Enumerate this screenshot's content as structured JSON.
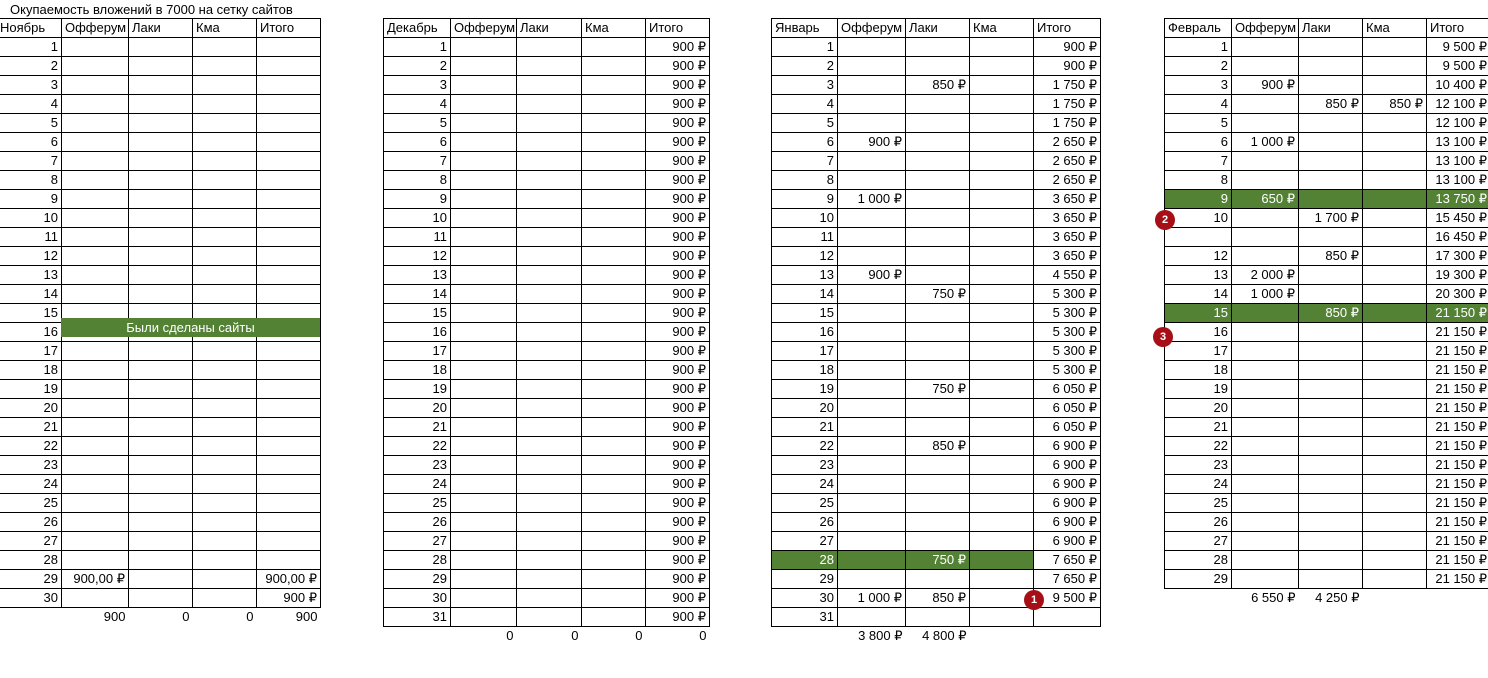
{
  "title": "Окупаемость вложений в 7000 на сетку сайтов",
  "banner": "Были сделаны сайты",
  "colors": {
    "green": "#548235",
    "badge": "#a50f15"
  },
  "badges": [
    "1",
    "2",
    "3"
  ],
  "november": {
    "headers": [
      "Ноябрь",
      "Офферум",
      "Лаки",
      "Кма",
      "Итого"
    ],
    "rows": [
      [
        "1",
        "",
        "",
        "",
        ""
      ],
      [
        "2",
        "",
        "",
        "",
        ""
      ],
      [
        "3",
        "",
        "",
        "",
        ""
      ],
      [
        "4",
        "",
        "",
        "",
        ""
      ],
      [
        "5",
        "",
        "",
        "",
        ""
      ],
      [
        "6",
        "",
        "",
        "",
        ""
      ],
      [
        "7",
        "",
        "",
        "",
        ""
      ],
      [
        "8",
        "",
        "",
        "",
        ""
      ],
      [
        "9",
        "",
        "",
        "",
        ""
      ],
      [
        "10",
        "",
        "",
        "",
        ""
      ],
      [
        "11",
        "",
        "",
        "",
        ""
      ],
      [
        "12",
        "",
        "",
        "",
        ""
      ],
      [
        "13",
        "",
        "",
        "",
        ""
      ],
      [
        "14",
        "",
        "",
        "",
        ""
      ],
      [
        "15",
        "",
        "",
        "",
        ""
      ],
      [
        "16",
        "",
        "",
        "",
        ""
      ],
      [
        "17",
        "",
        "",
        "",
        ""
      ],
      [
        "18",
        "",
        "",
        "",
        ""
      ],
      [
        "19",
        "",
        "",
        "",
        ""
      ],
      [
        "20",
        "",
        "",
        "",
        ""
      ],
      [
        "21",
        "",
        "",
        "",
        ""
      ],
      [
        "22",
        "",
        "",
        "",
        ""
      ],
      [
        "23",
        "",
        "",
        "",
        ""
      ],
      [
        "24",
        "",
        "",
        "",
        ""
      ],
      [
        "25",
        "",
        "",
        "",
        ""
      ],
      [
        "26",
        "",
        "",
        "",
        ""
      ],
      [
        "27",
        "",
        "",
        "",
        ""
      ],
      [
        "28",
        "",
        "",
        "",
        ""
      ],
      [
        "29",
        "900,00 ₽",
        "",
        "",
        "900,00 ₽"
      ],
      [
        "30",
        "",
        "",
        "",
        "900 ₽"
      ]
    ],
    "totals": [
      "",
      "900",
      "0",
      "0",
      "900"
    ]
  },
  "december": {
    "headers": [
      "Декабрь",
      "Офферум",
      "Лаки",
      "Кма",
      "Итого"
    ],
    "rows": [
      [
        "1",
        "",
        "",
        "",
        "900 ₽"
      ],
      [
        "2",
        "",
        "",
        "",
        "900 ₽"
      ],
      [
        "3",
        "",
        "",
        "",
        "900 ₽"
      ],
      [
        "4",
        "",
        "",
        "",
        "900 ₽"
      ],
      [
        "5",
        "",
        "",
        "",
        "900 ₽"
      ],
      [
        "6",
        "",
        "",
        "",
        "900 ₽"
      ],
      [
        "7",
        "",
        "",
        "",
        "900 ₽"
      ],
      [
        "8",
        "",
        "",
        "",
        "900 ₽"
      ],
      [
        "9",
        "",
        "",
        "",
        "900 ₽"
      ],
      [
        "10",
        "",
        "",
        "",
        "900 ₽"
      ],
      [
        "11",
        "",
        "",
        "",
        "900 ₽"
      ],
      [
        "12",
        "",
        "",
        "",
        "900 ₽"
      ],
      [
        "13",
        "",
        "",
        "",
        "900 ₽"
      ],
      [
        "14",
        "",
        "",
        "",
        "900 ₽"
      ],
      [
        "15",
        "",
        "",
        "",
        "900 ₽"
      ],
      [
        "16",
        "",
        "",
        "",
        "900 ₽"
      ],
      [
        "17",
        "",
        "",
        "",
        "900 ₽"
      ],
      [
        "18",
        "",
        "",
        "",
        "900 ₽"
      ],
      [
        "19",
        "",
        "",
        "",
        "900 ₽"
      ],
      [
        "20",
        "",
        "",
        "",
        "900 ₽"
      ],
      [
        "21",
        "",
        "",
        "",
        "900 ₽"
      ],
      [
        "22",
        "",
        "",
        "",
        "900 ₽"
      ],
      [
        "23",
        "",
        "",
        "",
        "900 ₽"
      ],
      [
        "24",
        "",
        "",
        "",
        "900 ₽"
      ],
      [
        "25",
        "",
        "",
        "",
        "900 ₽"
      ],
      [
        "26",
        "",
        "",
        "",
        "900 ₽"
      ],
      [
        "27",
        "",
        "",
        "",
        "900 ₽"
      ],
      [
        "28",
        "",
        "",
        "",
        "900 ₽"
      ],
      [
        "29",
        "",
        "",
        "",
        "900 ₽"
      ],
      [
        "30",
        "",
        "",
        "",
        "900 ₽"
      ],
      [
        "31",
        "",
        "",
        "",
        "900 ₽"
      ]
    ],
    "totals": [
      "",
      "0",
      "0",
      "0",
      "0"
    ]
  },
  "january": {
    "headers": [
      "Январь",
      "Офферум",
      "Лаки",
      "Кма",
      "Итого"
    ],
    "rows": [
      [
        "1",
        "",
        "",
        "",
        "900 ₽"
      ],
      [
        "2",
        "",
        "",
        "",
        "900 ₽"
      ],
      [
        "3",
        "",
        "850 ₽",
        "",
        "1 750 ₽"
      ],
      [
        "4",
        "",
        "",
        "",
        "1 750 ₽"
      ],
      [
        "5",
        "",
        "",
        "",
        "1 750 ₽"
      ],
      [
        "6",
        "900 ₽",
        "",
        "",
        "2 650 ₽"
      ],
      [
        "7",
        "",
        "",
        "",
        "2 650 ₽"
      ],
      [
        "8",
        "",
        "",
        "",
        "2 650 ₽"
      ],
      [
        "9",
        "1 000 ₽",
        "",
        "",
        "3 650 ₽"
      ],
      [
        "10",
        "",
        "",
        "",
        "3 650 ₽"
      ],
      [
        "11",
        "",
        "",
        "",
        "3 650 ₽"
      ],
      [
        "12",
        "",
        "",
        "",
        "3 650 ₽"
      ],
      [
        "13",
        "900 ₽",
        "",
        "",
        "4 550 ₽"
      ],
      [
        "14",
        "",
        "750 ₽",
        "",
        "5 300 ₽"
      ],
      [
        "15",
        "",
        "",
        "",
        "5 300 ₽"
      ],
      [
        "16",
        "",
        "",
        "",
        "5 300 ₽"
      ],
      [
        "17",
        "",
        "",
        "",
        "5 300 ₽"
      ],
      [
        "18",
        "",
        "",
        "",
        "5 300 ₽"
      ],
      [
        "19",
        "",
        "750 ₽",
        "",
        "6 050 ₽"
      ],
      [
        "20",
        "",
        "",
        "",
        "6 050 ₽"
      ],
      [
        "21",
        "",
        "",
        "",
        "6 050 ₽"
      ],
      [
        "22",
        "",
        "850 ₽",
        "",
        "6 900 ₽"
      ],
      [
        "23",
        "",
        "",
        "",
        "6 900 ₽"
      ],
      [
        "24",
        "",
        "",
        "",
        "6 900 ₽"
      ],
      [
        "25",
        "",
        "",
        "",
        "6 900 ₽"
      ],
      [
        "26",
        "",
        "",
        "",
        "6 900 ₽"
      ],
      [
        "27",
        "",
        "",
        "",
        "6 900 ₽"
      ],
      [
        "28",
        "",
        "750 ₽",
        "",
        "7 650 ₽"
      ],
      [
        "29",
        "",
        "",
        "",
        "7 650 ₽"
      ],
      [
        "30",
        "1 000 ₽",
        "850 ₽",
        "",
        "9 500 ₽"
      ],
      [
        "31",
        "",
        "",
        "",
        ""
      ]
    ],
    "totals": [
      "",
      "3 800 ₽",
      "4 800 ₽",
      "",
      ""
    ]
  },
  "february": {
    "headers": [
      "Февраль",
      "Офферум",
      "Лаки",
      "Кма",
      "Итого"
    ],
    "rows": [
      [
        "1",
        "",
        "",
        "",
        "9 500 ₽"
      ],
      [
        "2",
        "",
        "",
        "",
        "9 500 ₽"
      ],
      [
        "3",
        "900 ₽",
        "",
        "",
        "10 400 ₽"
      ],
      [
        "4",
        "",
        "850 ₽",
        "850 ₽",
        "12 100 ₽"
      ],
      [
        "5",
        "",
        "",
        "",
        "12 100 ₽"
      ],
      [
        "6",
        "1 000 ₽",
        "",
        "",
        "13 100 ₽"
      ],
      [
        "7",
        "",
        "",
        "",
        "13 100 ₽"
      ],
      [
        "8",
        "",
        "",
        "",
        "13 100 ₽"
      ],
      [
        "9",
        "650 ₽",
        "",
        "",
        "13 750 ₽"
      ],
      [
        "10",
        "",
        "1 700 ₽",
        "",
        "15 450 ₽"
      ],
      [
        "",
        "",
        "",
        "",
        "16 450 ₽"
      ],
      [
        "12",
        "",
        "850 ₽",
        "",
        "17 300 ₽"
      ],
      [
        "13",
        "2 000 ₽",
        "",
        "",
        "19 300 ₽"
      ],
      [
        "14",
        "1 000 ₽",
        "",
        "",
        "20 300 ₽"
      ],
      [
        "15",
        "",
        "850 ₽",
        "",
        "21 150 ₽"
      ],
      [
        "16",
        "",
        "",
        "",
        "21 150 ₽"
      ],
      [
        "17",
        "",
        "",
        "",
        "21 150 ₽"
      ],
      [
        "18",
        "",
        "",
        "",
        "21 150 ₽"
      ],
      [
        "19",
        "",
        "",
        "",
        "21 150 ₽"
      ],
      [
        "20",
        "",
        "",
        "",
        "21 150 ₽"
      ],
      [
        "21",
        "",
        "",
        "",
        "21 150 ₽"
      ],
      [
        "22",
        "",
        "",
        "",
        "21 150 ₽"
      ],
      [
        "23",
        "",
        "",
        "",
        "21 150 ₽"
      ],
      [
        "24",
        "",
        "",
        "",
        "21 150 ₽"
      ],
      [
        "25",
        "",
        "",
        "",
        "21 150 ₽"
      ],
      [
        "26",
        "",
        "",
        "",
        "21 150 ₽"
      ],
      [
        "27",
        "",
        "",
        "",
        "21 150 ₽"
      ],
      [
        "28",
        "",
        "",
        "",
        "21 150 ₽"
      ],
      [
        "29",
        "",
        "",
        "",
        "21 150 ₽"
      ]
    ],
    "totals": [
      "",
      "6 550 ₽",
      "4 250 ₽",
      "",
      ""
    ]
  }
}
